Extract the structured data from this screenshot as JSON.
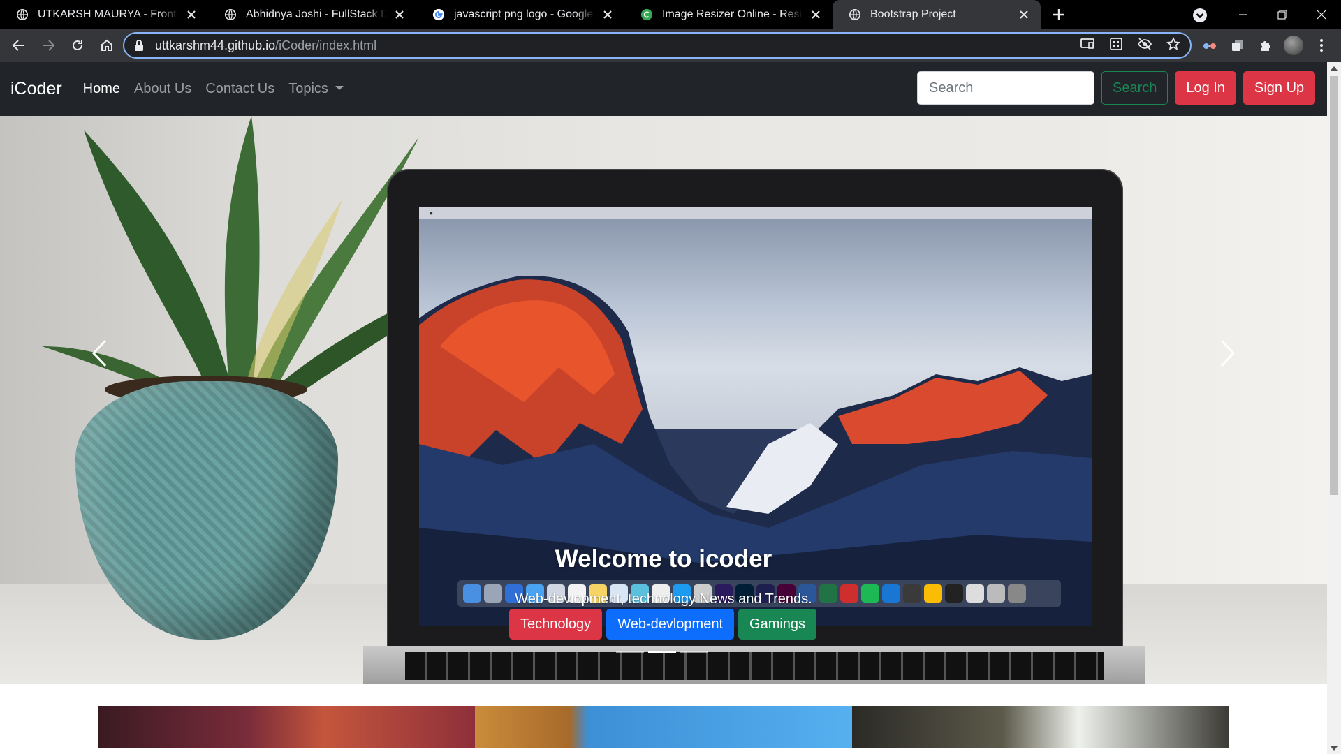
{
  "browser": {
    "tabs": [
      {
        "title": "UTKARSH MAURYA - Front-End D",
        "favicon": "globe-icon",
        "active": false
      },
      {
        "title": "Abhidnya Joshi - FullStack Develo",
        "favicon": "globe-icon",
        "active": false
      },
      {
        "title": "javascript png logo - Google Sea",
        "favicon": "google-icon",
        "active": false
      },
      {
        "title": "Image Resizer Online - Resize JPG",
        "favicon": "resizer-icon",
        "active": false
      },
      {
        "title": "Bootstrap Project",
        "favicon": "globe-icon",
        "active": true
      }
    ],
    "url_host": "uttkarshm44.github.io",
    "url_path": "/iCoder/index.html"
  },
  "site": {
    "brand": "iCoder",
    "nav": [
      {
        "label": "Home",
        "active": true
      },
      {
        "label": "About Us",
        "active": false
      },
      {
        "label": "Contact Us",
        "active": false
      },
      {
        "label": "Topics",
        "active": false,
        "dropdown": true
      }
    ],
    "search_placeholder": "Search",
    "search_button": "Search",
    "login_button": "Log In",
    "signup_button": "Sign Up"
  },
  "hero": {
    "title": "Welcome to icoder",
    "subtitle": "Web-devlopment, technology News and Trends.",
    "buttons": [
      {
        "label": "Technology",
        "color": "#dc3545"
      },
      {
        "label": "Web-devlopment",
        "color": "#0d6efd"
      },
      {
        "label": "Gamings",
        "color": "#198754"
      }
    ],
    "indicators": 3,
    "active_indicator": 1
  },
  "colors": {
    "navbar_bg": "#212529",
    "chrome_bg": "#35363a",
    "tab_strip_bg": "#000000",
    "omnibox_focus": "#8ab4f8",
    "success": "#198754",
    "danger": "#dc3545",
    "primary": "#0d6efd"
  }
}
